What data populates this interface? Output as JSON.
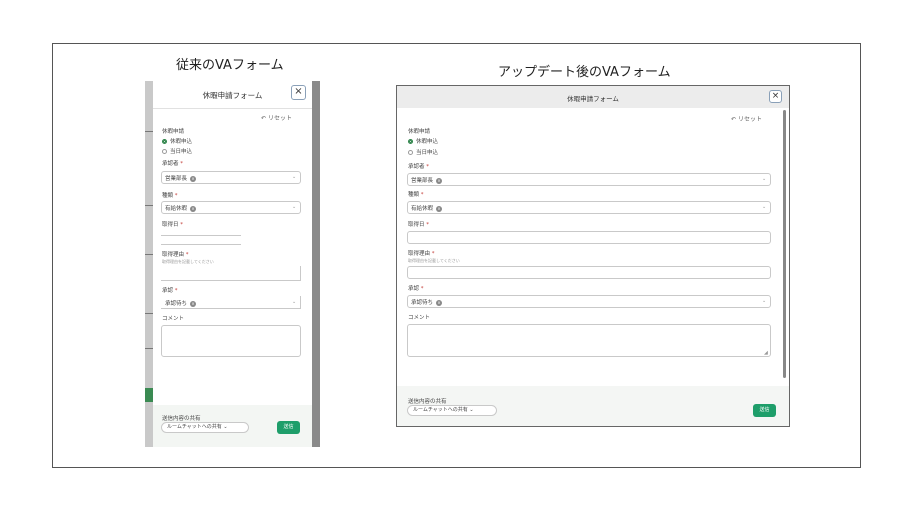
{
  "headings": {
    "old": "従来のVAフォーム",
    "new": "アップデート後のVAフォーム"
  },
  "form": {
    "title": "休暇申請フォーム",
    "close": "×",
    "reset": "リセット",
    "apply_type_label": "休暇申請",
    "radio1": "休暇申込",
    "radio2": "当日申込",
    "dept_label": "承認者",
    "dept_value": "営業部長",
    "type_label": "種類",
    "type_value": "有給休暇",
    "date_label": "取得日",
    "reason_label": "取得理由",
    "reason_hint": "取得理由を記載してください",
    "status_label": "承認",
    "status_value": "承認待ち",
    "comment_label": "コメント",
    "footer_label": "送信内容の共有",
    "footer_select": "ルームチャットへの共有",
    "send": "送信"
  }
}
